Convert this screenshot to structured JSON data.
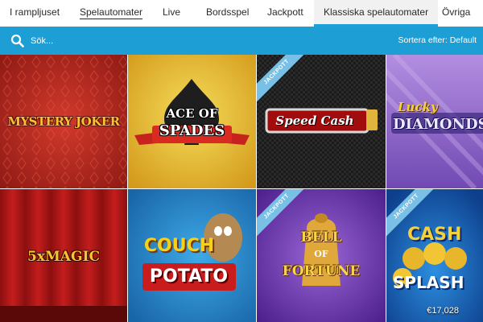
{
  "nav": {
    "tabs": [
      {
        "label": "I rampljuset"
      },
      {
        "label": "Spelautomater"
      },
      {
        "label": "Live"
      },
      {
        "label": "Bordsspel"
      },
      {
        "label": "Jackpott"
      },
      {
        "label": "Klassiska spelautomater"
      },
      {
        "label": "Övriga"
      }
    ],
    "active_tab": "Klassiska spelautomater"
  },
  "search": {
    "placeholder": "Sök...",
    "sort_label": "Sortera efter: Default",
    "icon": "search-icon"
  },
  "colors": {
    "accent": "#1d9fd6",
    "ribbon": "#79c0e6"
  },
  "games": [
    {
      "title": "MYSTERY JOKER",
      "jackpot_label": ""
    },
    {
      "title_line1": "ACE OF",
      "title_line2": "SPADES",
      "jackpot_label": ""
    },
    {
      "title": "Speed Cash",
      "jackpot_label": "JACKPOTT"
    },
    {
      "title_line1": "Lucky",
      "title_line2": "DIAMONDS",
      "jackpot_label": ""
    },
    {
      "title": "5xMAGIC",
      "jackpot_label": ""
    },
    {
      "title_line1": "COUCH",
      "title_line2": "POTATO",
      "jackpot_label": ""
    },
    {
      "title_line1": "BELL",
      "title_line2": "OF",
      "title_line3": "FORTUNE",
      "jackpot_label": "JACKPOTT"
    },
    {
      "title_line1": "CASH",
      "title_line2": "SPLASH",
      "jackpot_label": "JACKPOTT",
      "jackpot_amount": "€17,028"
    }
  ]
}
